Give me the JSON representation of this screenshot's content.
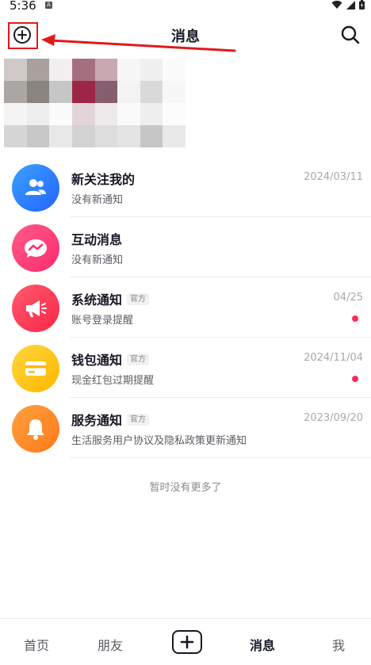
{
  "status_bar": {
    "time": "5:36",
    "notification_badge": "A"
  },
  "header": {
    "title": "消息"
  },
  "messages": [
    {
      "title": "新关注我的",
      "subtitle": "没有新通知",
      "date": "2024/03/11",
      "tag": "",
      "icon": "followers-icon",
      "color_from": "#3aa1ff",
      "color_to": "#2563ff"
    },
    {
      "title": "互动消息",
      "subtitle": "没有新通知",
      "date": "",
      "tag": "",
      "icon": "interaction-icon",
      "color_from": "#ff5a8a",
      "color_to": "#fe2c6e"
    },
    {
      "title": "系统通知",
      "subtitle": "账号登录提醒",
      "date": "04/25",
      "tag": "官方",
      "icon": "megaphone-icon",
      "color_from": "#ff5a6e",
      "color_to": "#fb2747"
    },
    {
      "title": "钱包通知",
      "subtitle": "现金红包过期提醒",
      "date": "2024/11/04",
      "tag": "官方",
      "icon": "wallet-icon",
      "color_from": "#ffd53d",
      "color_to": "#ffb800"
    },
    {
      "title": "服务通知",
      "subtitle": "生活服务用户协议及隐私政策更新通知",
      "date": "2023/09/20",
      "tag": "官方",
      "icon": "bell-icon",
      "color_from": "#ffa040",
      "color_to": "#ff7a1a"
    }
  ],
  "footer_text": "暂时没有更多了",
  "bottom_nav": {
    "home": "首页",
    "friends": "朋友",
    "messages": "消息",
    "me": "我"
  },
  "colors": {
    "accent": "#fe2c55",
    "annotation": "#e01a1a"
  }
}
